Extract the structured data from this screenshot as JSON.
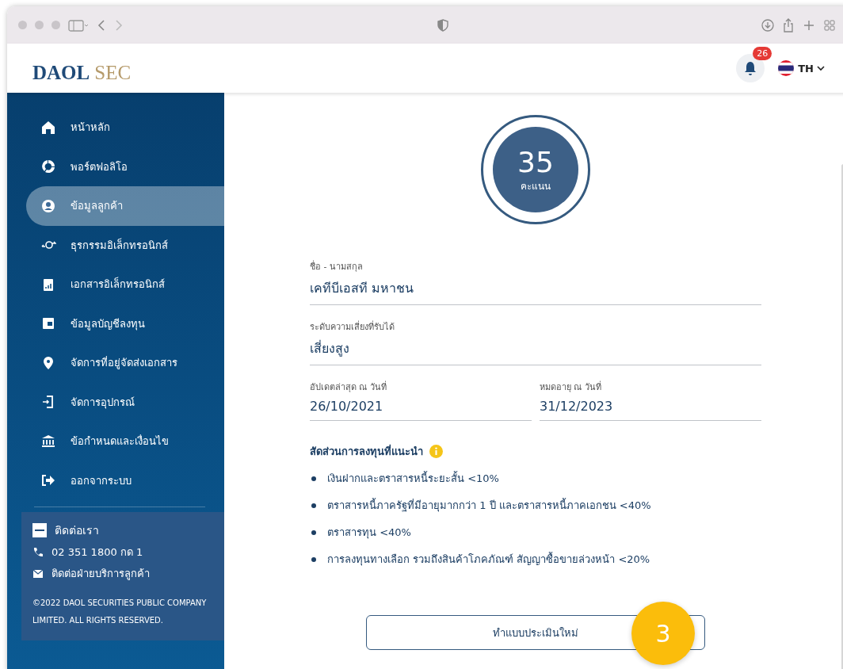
{
  "header": {
    "logo_primary": "DAOL",
    "logo_secondary": "SEC",
    "notification_count": "26",
    "language": "TH"
  },
  "sidebar": {
    "items": [
      {
        "label": "หน้าหลัก",
        "selected": false
      },
      {
        "label": "พอร์ตฟอลิโอ",
        "selected": false
      },
      {
        "label": "ข้อมูลลูกค้า",
        "selected": true
      },
      {
        "label": "ธุรกรรมอิเล็กทรอนิกส์",
        "selected": false
      },
      {
        "label": "เอกสารอิเล็กทรอนิกส์",
        "selected": false
      },
      {
        "label": "ข้อมูลบัญชีลงทุน",
        "selected": false
      },
      {
        "label": "จัดการที่อยู่จัดส่งเอกสาร",
        "selected": false
      },
      {
        "label": "จัดการอุปกรณ์",
        "selected": false
      },
      {
        "label": "ข้อกำหนดและเงื่อนไข",
        "selected": false
      },
      {
        "label": "ออกจากระบบ",
        "selected": false
      }
    ],
    "contact": {
      "title": "ติดต่อเรา",
      "phone": "02 351 1800 กด 1",
      "email_label": "ติดต่อฝ่ายบริการลูกค้า",
      "copyright": "©2022 DAOL SECURITIES PUBLIC COMPANY LIMITED. ALL RIGHTS RESERVED."
    }
  },
  "score": {
    "value": "35",
    "unit": "คะแนน"
  },
  "fields": [
    {
      "label": "ชื่อ - นามสกุล",
      "value": "เคทีบีเอสที มหาชน"
    },
    {
      "label": "ระดับความเสี่ยงที่รับได้",
      "value": "เสี่ยงสูง"
    }
  ],
  "date_fields": [
    {
      "label": "อัปเดตล่าสุด ณ วันที่",
      "value": "26/10/2021"
    },
    {
      "label": "หมดอายุ ณ วันที่",
      "value": "31/12/2023"
    }
  ],
  "allocation": {
    "title": "สัดส่วนการลงทุนที่แนะนำ",
    "items": [
      "เงินฝากและตราสารหนี้ระยะสั้น <10%",
      "ตราสารหนี้ภาครัฐที่มีอายุมากกว่า 1 ปี และตราสารหนี้ภาคเอกชน <40%",
      "ตราสารทุน <40%",
      "การลงทุนทางเลือก รวมถึงสินค้าโภคภัณฑ์ สัญญาซื้อขายล่วงหน้า <20%"
    ]
  },
  "reassess_button": "ทำแบบประเมินใหม่",
  "callout": "3"
}
